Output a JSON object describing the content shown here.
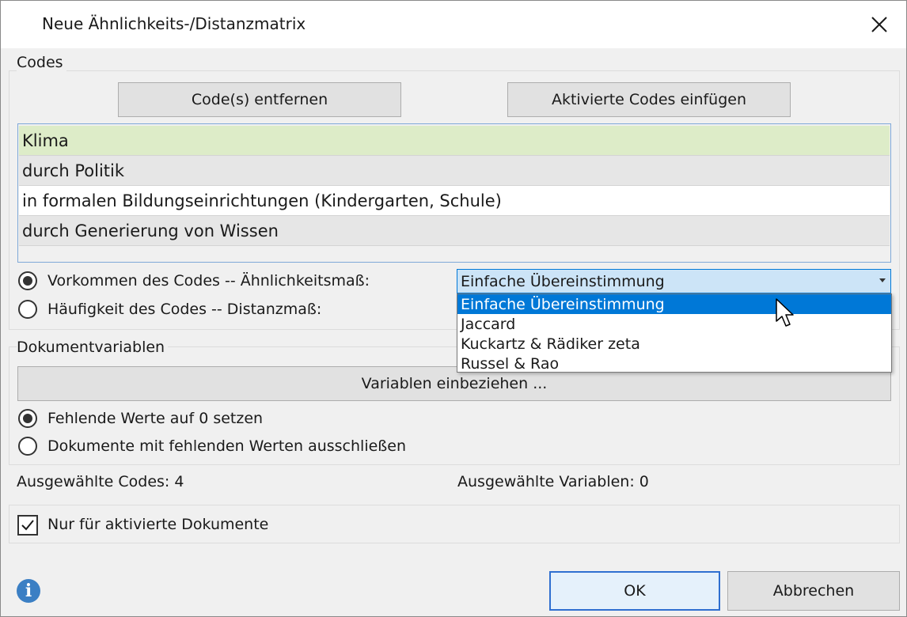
{
  "window": {
    "title": "Neue Ähnlichkeits-/Distanzmatrix"
  },
  "codes": {
    "group_label": "Codes",
    "remove_label": "Code(s) entfernen",
    "insert_label": "Aktivierte Codes einfügen",
    "items": [
      {
        "label": "Klima",
        "bg": "#ddecc8"
      },
      {
        "label": "durch Politik",
        "bg": "#e6e6e6"
      },
      {
        "label": "in formalen Bildungseinrichtungen (Kindergarten, Schule)",
        "bg": "#ffffff"
      },
      {
        "label": "durch Generierung von Wissen",
        "bg": "#e6e6e6"
      }
    ],
    "occurrence_label": "Vorkommen des Codes -- Ähnlichkeitsmaß:",
    "frequency_label": "Häufigkeit des Codes -- Distanzmaß:",
    "similarity_selected": "Einfache Übereinstimmung",
    "similarity_options": [
      "Einfache Übereinstimmung",
      "Jaccard",
      "Kuckartz & Rädiker zeta",
      "Russel & Rao"
    ]
  },
  "docvars": {
    "group_label": "Dokumentvariablen",
    "include_label": "Variablen einbeziehen ...",
    "missing_zero_label": "Fehlende Werte auf 0 setzen",
    "missing_exclude_label": "Dokumente mit fehlenden Werten ausschließen"
  },
  "status": {
    "selected_codes": "Ausgewählte Codes: 4",
    "selected_vars": "Ausgewählte Variablen: 0"
  },
  "options": {
    "only_active_label": "Nur für aktivierte Dokumente"
  },
  "footer": {
    "ok_label": "OK",
    "cancel_label": "Abbrechen"
  },
  "colors": {
    "accent": "#0078d7",
    "info": "#3b7fc4",
    "highlight_row": "#ddecc8"
  }
}
